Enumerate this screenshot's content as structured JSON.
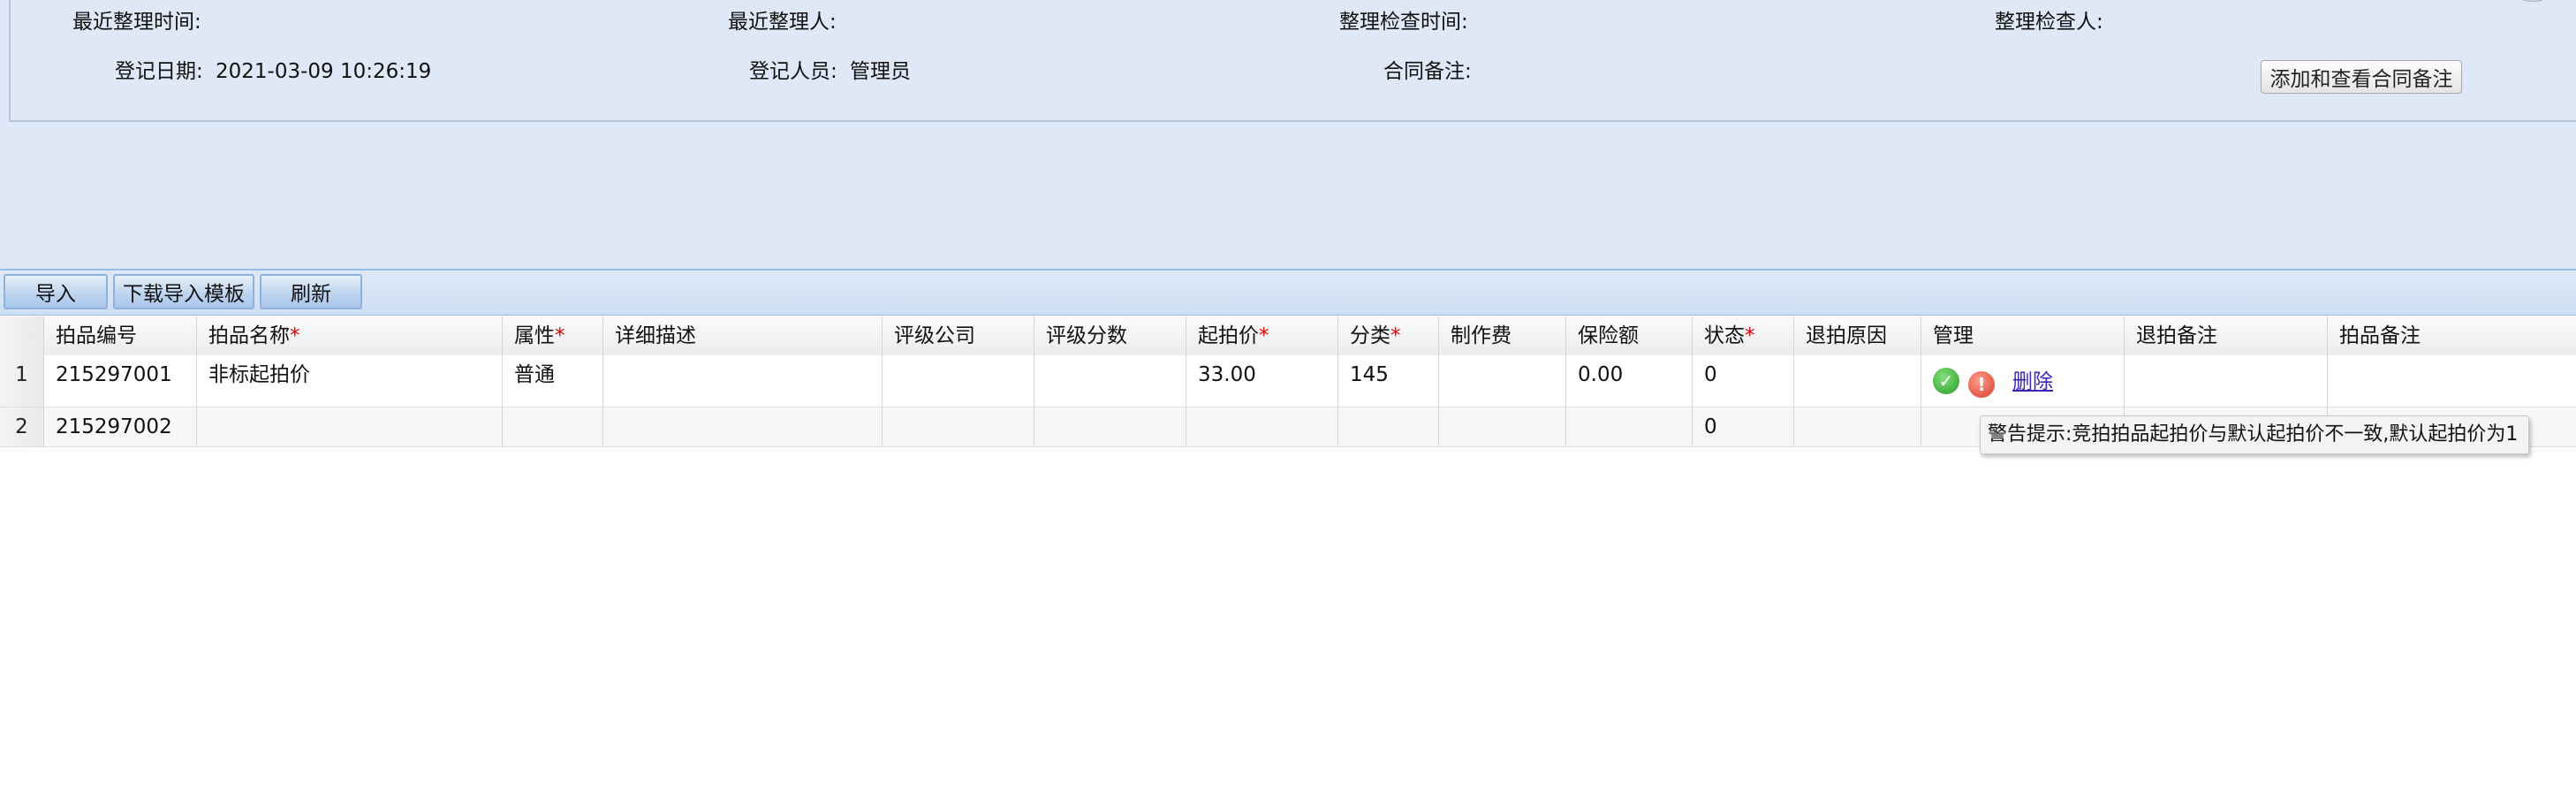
{
  "info": {
    "last_org_time_label": "最近整理时间:",
    "last_org_person_label": "最近整理人:",
    "org_check_time_label": "整理检查时间:",
    "org_checker_label": "整理检查人:",
    "reg_date_label": "登记日期:",
    "reg_date_value": "2021-03-09 10:26:19",
    "reg_person_label": "登记人员:",
    "reg_person_value": "管理员",
    "contract_note_label": "合同备注:",
    "contract_note_button": "添加和查看合同备注"
  },
  "toolbar": {
    "import_label": "导入",
    "download_template_label": "下载导入模板",
    "refresh_label": "刷新"
  },
  "grid": {
    "columns": [
      "拍品编号",
      "拍品名称",
      "属性",
      "详细描述",
      "评级公司",
      "评级分数",
      "起拍价",
      "分类",
      "制作费",
      "保险额",
      "状态",
      "退拍原因",
      "管理",
      "退拍备注",
      "拍品备注"
    ],
    "required_mark": "*",
    "rows": [
      {
        "num": "1",
        "lot_no": "215297001",
        "lot_name": "非标起拍价",
        "attr": "普通",
        "desc": "",
        "rating_co": "",
        "rating_score": "",
        "start_price": "33.00",
        "category": "145",
        "making_fee": "",
        "insurance": "0.00",
        "status": "0",
        "withdraw_reason": "",
        "delete_label": "删除",
        "withdraw_note": "",
        "lot_note": ""
      },
      {
        "num": "2",
        "lot_no": "215297002",
        "lot_name": "",
        "attr": "",
        "desc": "",
        "rating_co": "",
        "rating_score": "",
        "start_price": "",
        "category": "",
        "making_fee": "",
        "insurance": "",
        "status": "0",
        "withdraw_reason": "",
        "withdraw_note": "",
        "lot_note": ""
      }
    ]
  },
  "tooltip": {
    "text": "警告提示:竞拍拍品起拍价与默认起拍价不一致,默认起拍价为1"
  },
  "icons": {
    "ok": "check-circle-icon",
    "warn": "exclamation-circle-icon"
  }
}
